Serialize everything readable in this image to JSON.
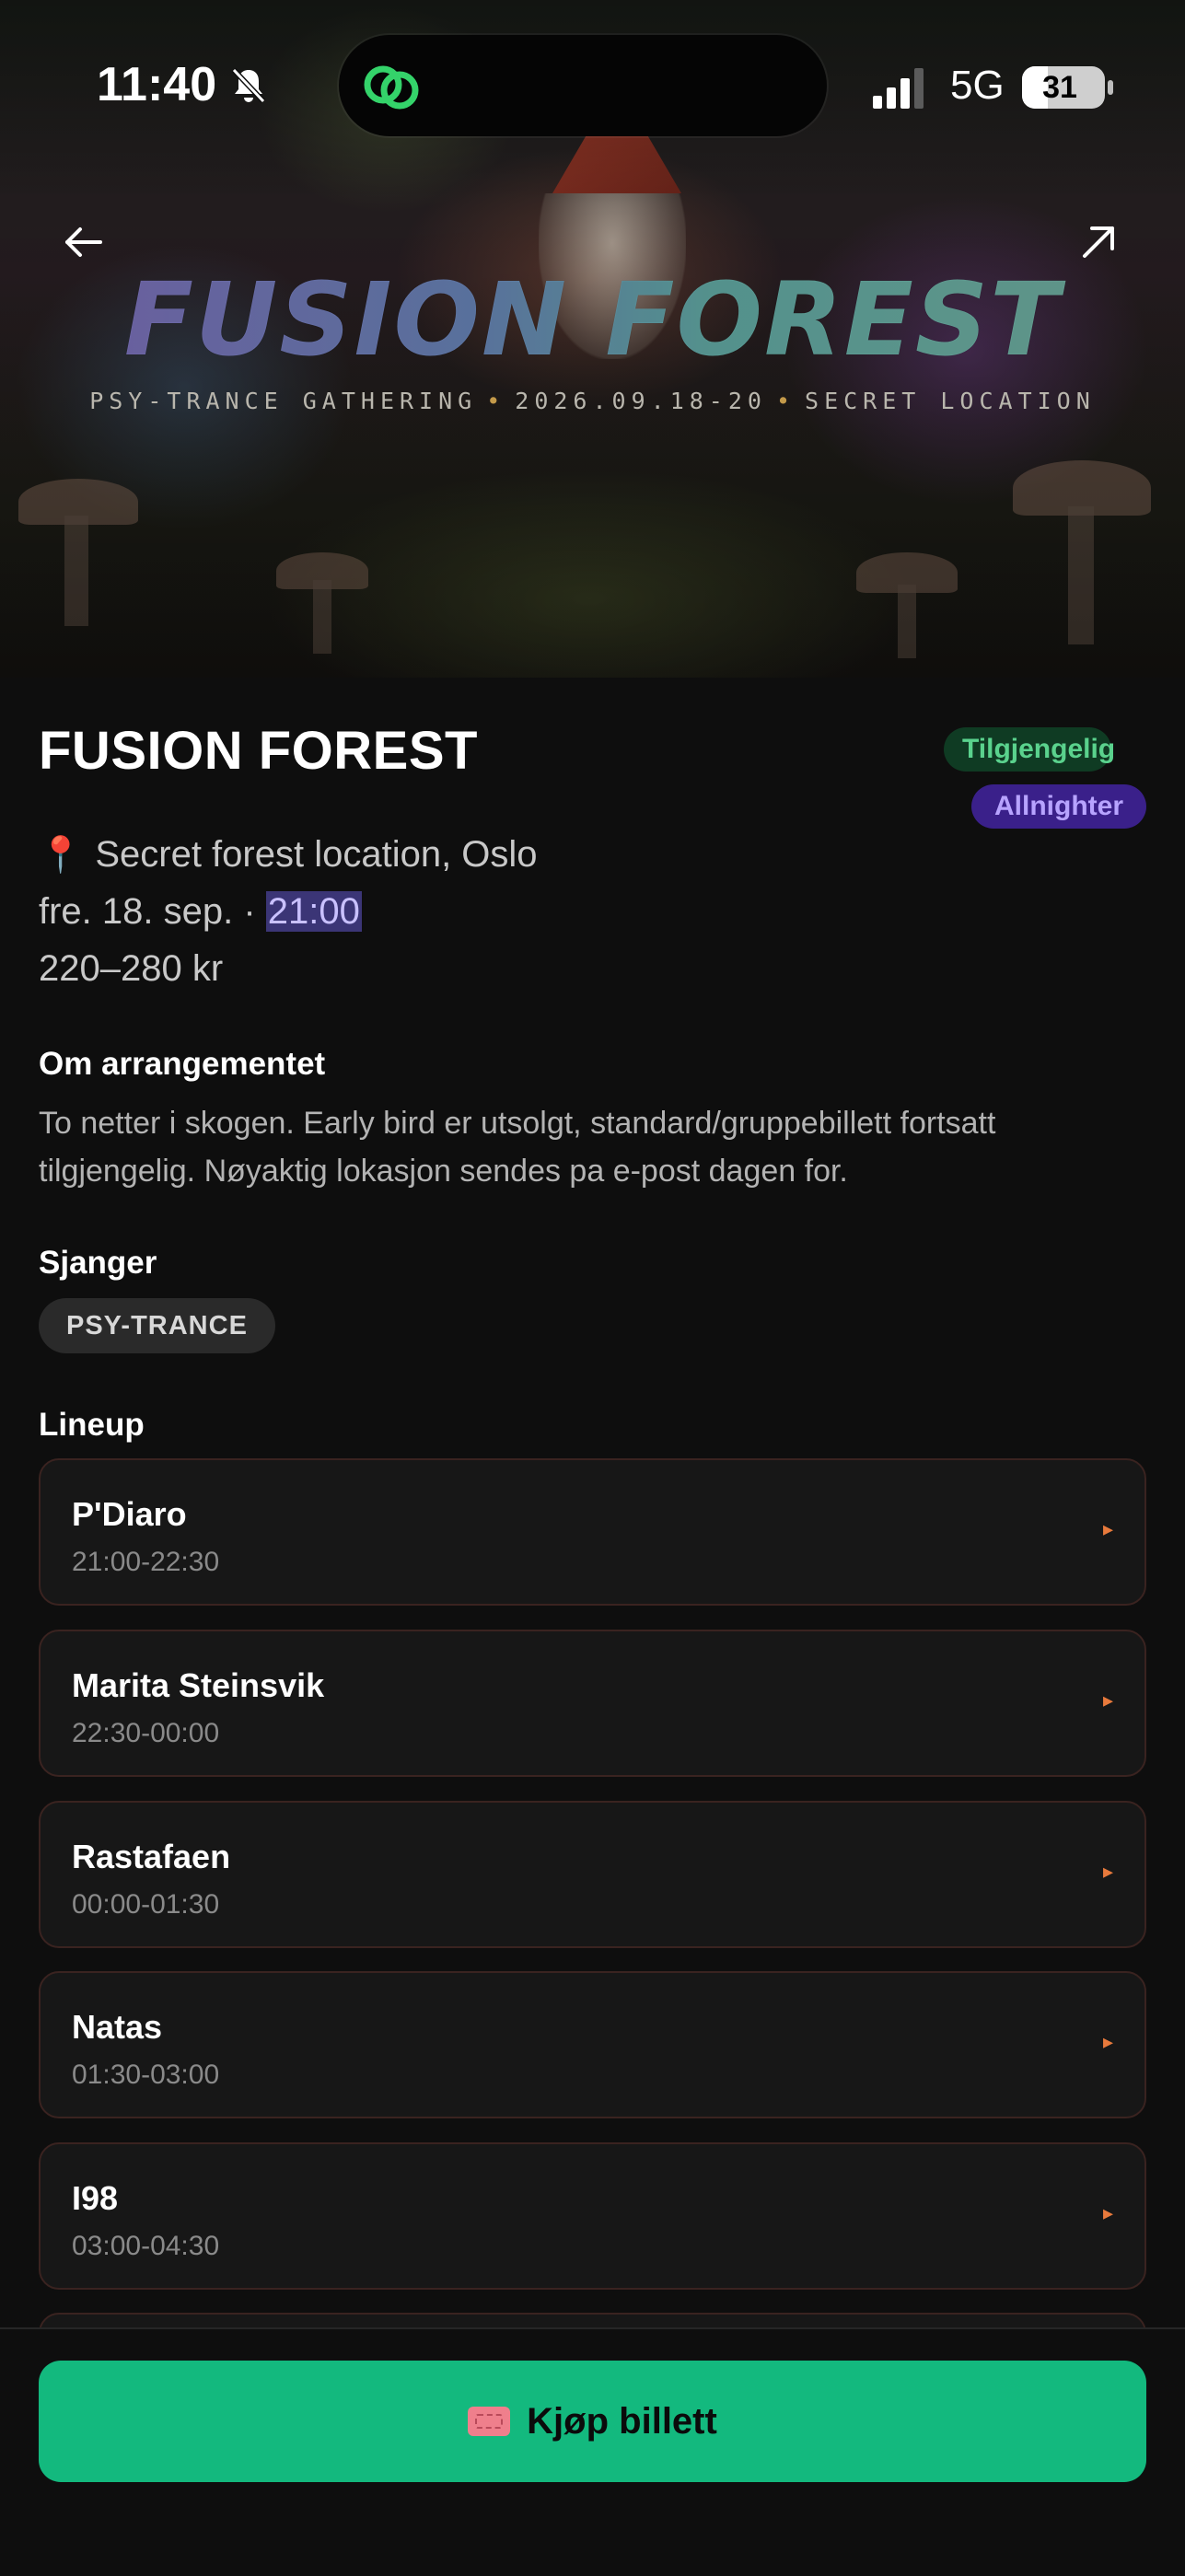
{
  "status_bar": {
    "time": "11:40",
    "network": "5G",
    "battery": "31",
    "battery_level": 0.31
  },
  "hero": {
    "title": "FUSION FOREST",
    "subtitle_parts": [
      "PSY-TRANCE GATHERING",
      "2026.09.18-20",
      "SECRET LOCATION"
    ],
    "separator": "•"
  },
  "event": {
    "title": "FUSION FOREST",
    "badges": {
      "availability": "Tilgjengelig",
      "type": "Allnighter"
    },
    "location_icon": "📍",
    "location": "Secret forest location, Oslo",
    "date": "fre. 18. sep. ·",
    "start_time": "21:00",
    "price": "220–280 kr"
  },
  "about": {
    "heading": "Om arrangementet",
    "text": "To netter i skogen. Early bird er utsolgt, standard/gruppebillett fortsatt tilgjengelig. Nøyaktig lokasjon sendes pa e-post dagen for."
  },
  "genres": {
    "heading": "Sjanger",
    "items": [
      "PSY-TRANCE"
    ]
  },
  "lineup": {
    "heading": "Lineup",
    "items": [
      {
        "artist": "P'Diaro",
        "slot": "21:00-22:30"
      },
      {
        "artist": "Marita Steinsvik",
        "slot": "22:30-00:00"
      },
      {
        "artist": "Rastafaen",
        "slot": "00:00-01:30"
      },
      {
        "artist": "Natas",
        "slot": "01:30-03:00"
      },
      {
        "artist": "I98",
        "slot": "03:00-04:30"
      }
    ],
    "arrow": "▸"
  },
  "cta": {
    "label": "Kjøp billett",
    "icon": "ticket-icon"
  },
  "colors": {
    "accent": "#13b97e",
    "available": "#5ad28d",
    "allnighter": "#3a208a"
  }
}
